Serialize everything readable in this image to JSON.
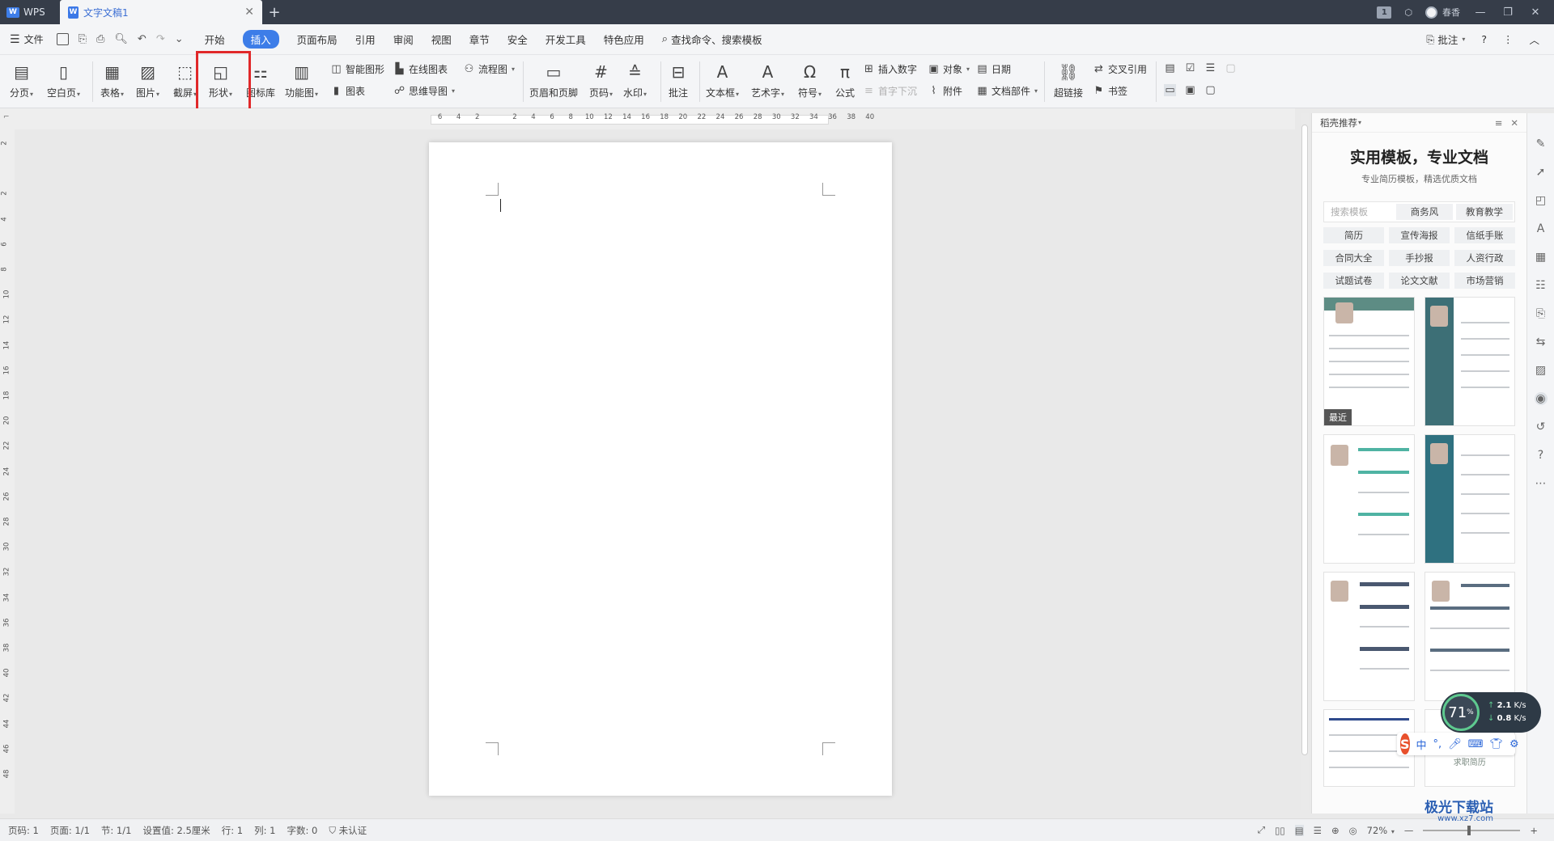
{
  "titlebar": {
    "app_tab": "WPS",
    "doc_tab": "文字文稿1",
    "user_name": "春香",
    "badge": "1"
  },
  "menubar": {
    "file": "文件",
    "tabs": [
      "开始",
      "插入",
      "页面布局",
      "引用",
      "审阅",
      "视图",
      "章节",
      "安全",
      "开发工具",
      "特色应用"
    ],
    "active_tab": "插入",
    "search": "查找命令、搜索模板",
    "comment": "批注",
    "help": "?"
  },
  "ribbon": {
    "page_break": "分页",
    "blank_page": "空白页",
    "table": "表格",
    "picture": "图片",
    "screenshot": "截屏",
    "shape": "形状",
    "icon_lib": "图标库",
    "func_chart": "功能图",
    "smart_art": "智能图形",
    "online_chart": "在线图表",
    "flowchart": "流程图",
    "chart": "图表",
    "mindmap": "思维导图",
    "header_footer": "页眉和页脚",
    "page_num": "页码",
    "watermark": "水印",
    "annotation": "批注",
    "textbox": "文本框",
    "wordart": "艺术字",
    "symbol": "符号",
    "formula": "公式",
    "insert_number": "插入数字",
    "drop_cap": "首字下沉",
    "object": "对象",
    "attachment": "附件",
    "date": "日期",
    "doc_parts": "文档部件",
    "hyperlink": "超链接",
    "cross_ref": "交叉引用",
    "bookmark": "书签"
  },
  "ruler": {
    "top": [
      "6",
      "4",
      "2",
      "",
      "2",
      "4",
      "6",
      "8",
      "10",
      "12",
      "14",
      "16",
      "18",
      "20",
      "22",
      "24",
      "26",
      "28",
      "30",
      "32",
      "34",
      "36",
      "38",
      "40"
    ],
    "left": [
      "2",
      "",
      "2",
      "4",
      "6",
      "8",
      "10",
      "12",
      "14",
      "16",
      "18",
      "20",
      "22",
      "24",
      "26",
      "28",
      "30",
      "32",
      "34",
      "36",
      "38",
      "40",
      "42",
      "44",
      "46",
      "48"
    ]
  },
  "panel": {
    "header": "稻壳推荐",
    "title": "实用模板，专业文档",
    "subtitle": "专业简历模板，精选优质文档",
    "search_placeholder": "搜索模板",
    "search_chips": [
      "商务风",
      "教育教学"
    ],
    "categories": [
      "简历",
      "宣传海报",
      "信纸手账",
      "合同大全",
      "手抄报",
      "人资行政",
      "试题试卷",
      "论文文献",
      "市场营销"
    ],
    "recent_label": "最近",
    "resume_card_label": "求职简历"
  },
  "status": {
    "page_num": "页码: 1",
    "page": "页面: 1/1",
    "section": "节: 1/1",
    "setting": "设置值: 2.5厘米",
    "row": "行: 1",
    "col": "列: 1",
    "words": "字数: 0",
    "cert": "未认证",
    "zoom": "72%"
  },
  "overlays": {
    "speed_percent": "71",
    "percent_sign": "%",
    "up_rate": "2.1",
    "down_rate": "0.8",
    "rate_unit": "K/s",
    "ime_logo": "S",
    "ime_mode": "中",
    "watermark_text": "极光下载站",
    "watermark_url": "www.xz7.com"
  },
  "colors": {
    "accent": "#3d7de8",
    "titlebar_bg": "#363d49",
    "highlight_box": "#e0282a"
  }
}
